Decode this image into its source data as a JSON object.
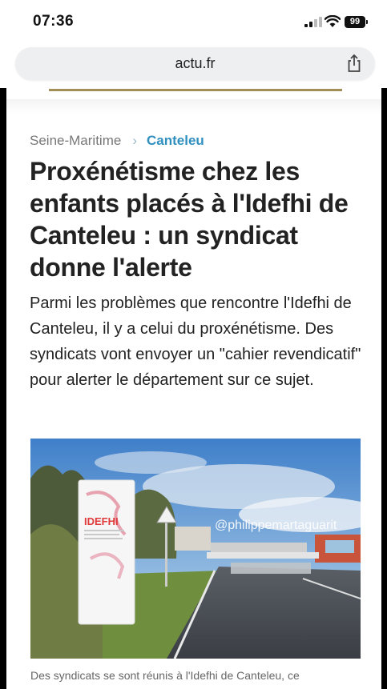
{
  "status_bar": {
    "time": "07:36",
    "battery": "99",
    "icons": [
      "signal-icon",
      "wifi-icon",
      "battery-icon"
    ]
  },
  "browser": {
    "url": "actu.fr",
    "share_icon": "share-icon"
  },
  "breadcrumb": {
    "parent": "Seine-Maritime",
    "current": "Canteleu"
  },
  "article": {
    "title": "Proxénétisme chez les enfants placés à l'Idefhi de Canteleu : un syndicat donne l'alerte",
    "lead": "Parmi les problèmes que rencontre l'Idefhi de Canteleu, il y a celui du proxénétisme. Des syndicats vont envoyer un \"cahier revendicatif\" pour alerter le département sur ce sujet.",
    "photo": {
      "sign_text": "IDEFHI",
      "watermark": "@philippemartaguarit"
    },
    "caption": "Des syndicats se sont réunis à l'Idefhi de Canteleu, ce"
  },
  "colors": {
    "accent_link": "#2f8fbf",
    "gold_rule": "#a38f55",
    "sign_red": "#e03a3a"
  }
}
